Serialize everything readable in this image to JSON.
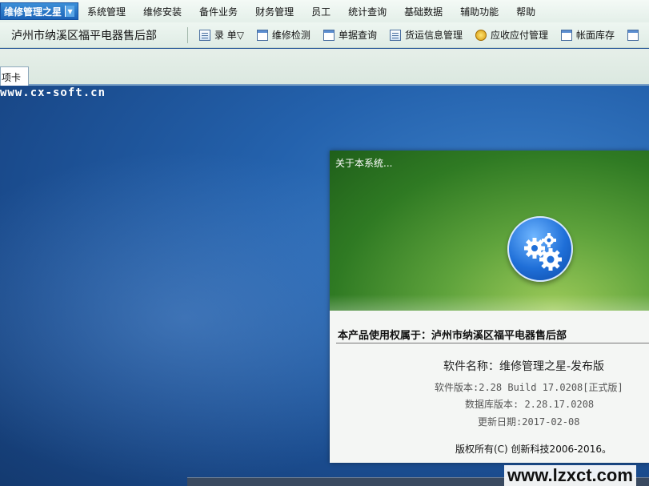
{
  "menubar": {
    "app_menu": "维修管理之星",
    "items": [
      "系统管理",
      "维修安装",
      "备件业务",
      "财务管理",
      "员工",
      "统计查询",
      "基础数据",
      "辅助功能",
      "帮助"
    ]
  },
  "toolbar": {
    "shop_title": "泸州市纳溪区福平电器售后部",
    "buttons": [
      {
        "label": "录 单▽",
        "icon": "document-icon"
      },
      {
        "label": "维修检测",
        "icon": "grid-icon"
      },
      {
        "label": "单据查询",
        "icon": "window-icon"
      },
      {
        "label": "货运信息管理",
        "icon": "list-icon"
      },
      {
        "label": "应收应付管理",
        "icon": "coin-icon"
      },
      {
        "label": "帐面库存",
        "icon": "window-icon"
      }
    ]
  },
  "tabs": {
    "active": "项卡"
  },
  "desktop": {
    "watermark": "www.cx-soft.cn"
  },
  "about": {
    "title": "关于本系统...",
    "owner": "本产品使用权属于：泸州市纳溪区福平电器售后部",
    "product_name": "软件名称：维修管理之星-发布版",
    "version": "软件版本:2.28 Build 17.0208[正式版]",
    "db_version": "数据库版本: 2.28.17.0208",
    "update_date": "更新日期:2017-02-08",
    "copyright": "版权所有(C) 创新科技2006-2016。",
    "colors": {
      "banner": "#3f8a2c",
      "badge": "#1f6fd8"
    }
  },
  "site_watermark": "www.lzxct.com"
}
